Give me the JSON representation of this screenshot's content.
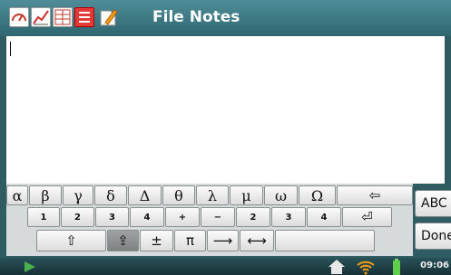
{
  "window": {
    "title": "File  Notes"
  },
  "toolbar": {
    "icons": [
      "gauge-icon",
      "graph-icon",
      "table-icon",
      "list-icon",
      "notes-icon"
    ]
  },
  "editor": {
    "text": ""
  },
  "keyboard": {
    "row1": [
      "α",
      "β",
      "γ",
      "δ",
      "Δ",
      "θ",
      "λ",
      "μ",
      "ω",
      "Ω",
      "⇦"
    ],
    "row2": [
      "1",
      "2",
      "3",
      "4",
      "+",
      "−",
      "2",
      "3",
      "4",
      "⏎"
    ],
    "row3": [
      "⇧",
      "⇪",
      "±",
      "π",
      "⟶",
      "⟷",
      ""
    ],
    "side": {
      "abc_label": "ABC",
      "done_label": "Done"
    }
  },
  "statusbar": {
    "time": "09:06",
    "icons": [
      "play-icon",
      "home-icon",
      "wifi-icon",
      "battery-icon"
    ]
  },
  "colors": {
    "titlebar": "#3f7a84",
    "accent": "#2f6670"
  }
}
